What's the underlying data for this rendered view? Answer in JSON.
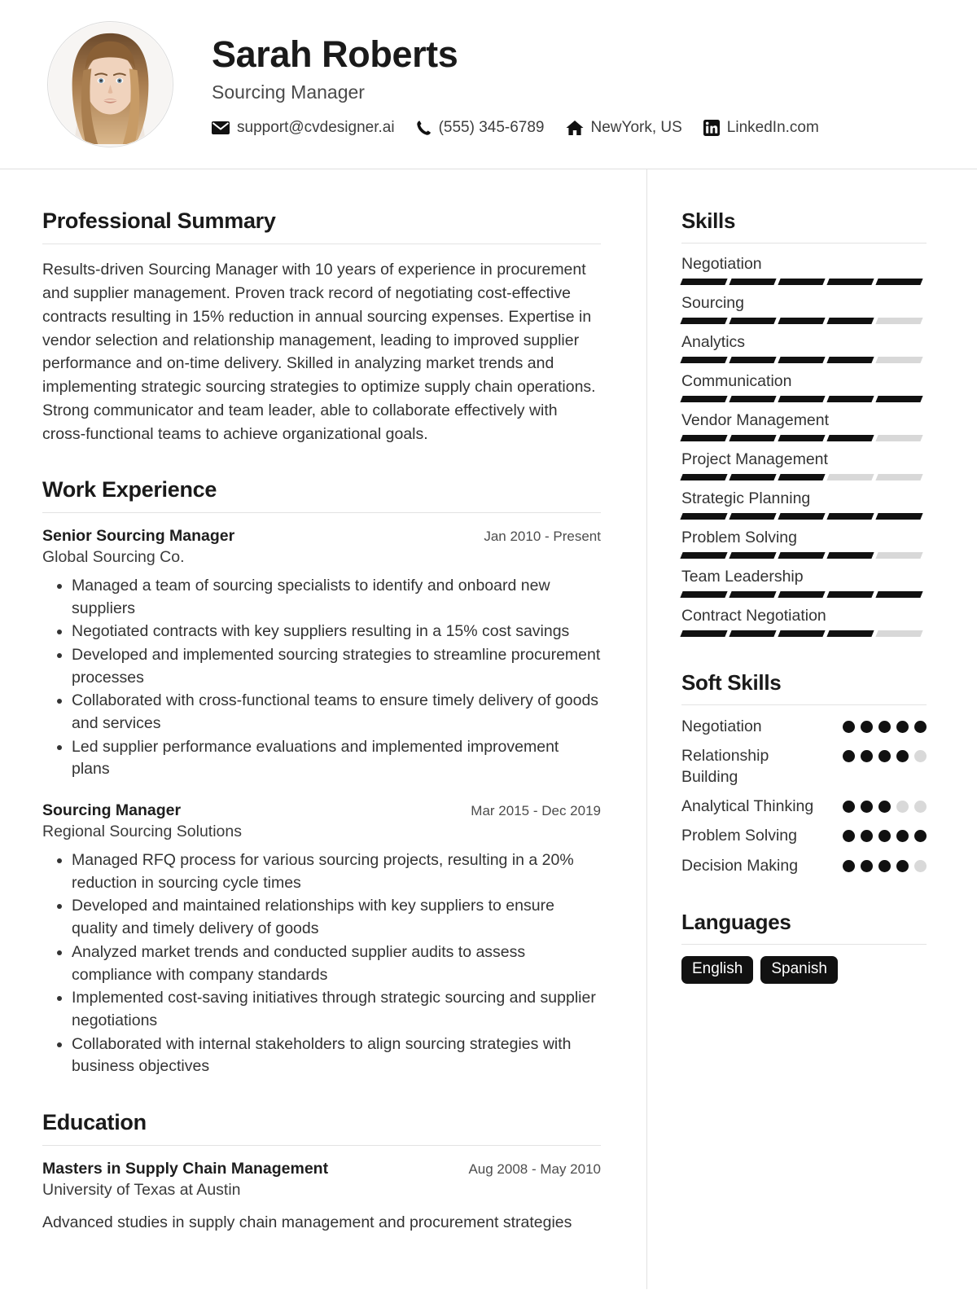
{
  "header": {
    "name": "Sarah Roberts",
    "title": "Sourcing Manager",
    "avatar_alt": "profile-photo",
    "contacts": [
      {
        "icon": "email-icon",
        "value": "support@cvdesigner.ai"
      },
      {
        "icon": "phone-icon",
        "value": "(555) 345-6789"
      },
      {
        "icon": "home-icon",
        "value": "NewYork, US"
      },
      {
        "icon": "linkedin-icon",
        "value": "LinkedIn.com"
      }
    ]
  },
  "main": {
    "summary": {
      "heading": "Professional Summary",
      "text": "Results-driven Sourcing Manager with 10 years of experience in procurement and supplier management. Proven track record of negotiating cost-effective contracts resulting in 15% reduction in annual sourcing expenses. Expertise in vendor selection and relationship management, leading to improved supplier performance and on-time delivery. Skilled in analyzing market trends and implementing strategic sourcing strategies to optimize supply chain operations. Strong communicator and team leader, able to collaborate effectively with cross-functional teams to achieve organizational goals."
    },
    "experience": {
      "heading": "Work Experience",
      "entries": [
        {
          "role": "Senior Sourcing Manager",
          "organization": "Global Sourcing Co.",
          "date": "Jan 2010 - Present",
          "bullets": [
            "Managed a team of sourcing specialists to identify and onboard new suppliers",
            "Negotiated contracts with key suppliers resulting in a 15% cost savings",
            "Developed and implemented sourcing strategies to streamline procurement processes",
            "Collaborated with cross-functional teams to ensure timely delivery of goods and services",
            "Led supplier performance evaluations and implemented improvement plans"
          ]
        },
        {
          "role": "Sourcing Manager",
          "organization": "Regional Sourcing Solutions",
          "date": "Mar 2015 - Dec 2019",
          "bullets": [
            "Managed RFQ process for various sourcing projects, resulting in a 20% reduction in sourcing cycle times",
            "Developed and maintained relationships with key suppliers to ensure quality and timely delivery of goods",
            "Analyzed market trends and conducted supplier audits to assess compliance with company standards",
            "Implemented cost-saving initiatives through strategic sourcing and supplier negotiations",
            "Collaborated with internal stakeholders to align sourcing strategies with business objectives"
          ]
        }
      ]
    },
    "education": {
      "heading": "Education",
      "entries": [
        {
          "degree": "Masters in Supply Chain Management",
          "school": "University of Texas at Austin",
          "date": "Aug 2008 - May 2010",
          "description": "Advanced studies in supply chain management and procurement strategies"
        }
      ]
    }
  },
  "sidebar": {
    "skills": {
      "heading": "Skills",
      "max": 5,
      "items": [
        {
          "label": "Negotiation",
          "level": 5
        },
        {
          "label": "Sourcing",
          "level": 4
        },
        {
          "label": "Analytics",
          "level": 4
        },
        {
          "label": "Communication",
          "level": 5
        },
        {
          "label": "Vendor Management",
          "level": 4
        },
        {
          "label": "Project Management",
          "level": 3
        },
        {
          "label": "Strategic Planning",
          "level": 5
        },
        {
          "label": "Problem Solving",
          "level": 4
        },
        {
          "label": "Team Leadership",
          "level": 5
        },
        {
          "label": "Contract Negotiation",
          "level": 4
        }
      ]
    },
    "soft_skills": {
      "heading": "Soft Skills",
      "max": 5,
      "items": [
        {
          "label": "Negotiation",
          "level": 5
        },
        {
          "label": "Relationship Building",
          "level": 4
        },
        {
          "label": "Analytical Thinking",
          "level": 3
        },
        {
          "label": "Problem Solving",
          "level": 5
        },
        {
          "label": "Decision Making",
          "level": 4
        }
      ]
    },
    "languages": {
      "heading": "Languages",
      "items": [
        "English",
        "Spanish"
      ]
    }
  },
  "colors": {
    "accent": "#111111",
    "muted_bar": "#d8d8d8",
    "rule": "#e3e3e3",
    "text": "#333333"
  }
}
